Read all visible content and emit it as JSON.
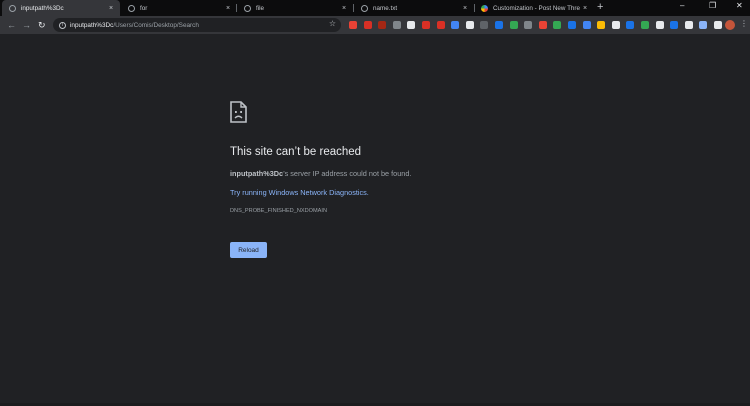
{
  "tabs": [
    {
      "title": "inputpath%3Dc",
      "active": true,
      "icon": "globe-icon"
    },
    {
      "title": "for",
      "active": false,
      "icon": "globe-icon"
    },
    {
      "title": "file",
      "active": false,
      "icon": "globe-icon"
    },
    {
      "title": "name.txt",
      "active": false,
      "icon": "globe-icon"
    },
    {
      "title": "Customization - Post New Thread",
      "active": false,
      "icon": "google-icon"
    }
  ],
  "tab_close_glyph": "×",
  "new_tab_glyph": "+",
  "window_controls": {
    "minimize": "–",
    "maximize": "❐",
    "close": "✕"
  },
  "toolbar": {
    "back": "←",
    "forward": "→",
    "reload": "↻",
    "address_host": "inputpath%3Dc",
    "address_path": "/Users/Comis/Desktop/Search",
    "star": "☆",
    "menu": "⋮"
  },
  "extensions": [
    "#e94235",
    "#d93025",
    "#a52714",
    "#80868b",
    "#e8eaed",
    "#d93025",
    "#d93025",
    "#4285f4",
    "#e8eaed",
    "#5f6368",
    "#1a73e8",
    "#34a853",
    "#80868b",
    "#ea4335",
    "#34a853",
    "#1a73e8",
    "#4285f4",
    "#fbbc05",
    "#e8eaed",
    "#1a73e8",
    "#34a853",
    "#e8eaed",
    "#1a73e8",
    "#e8eaed",
    "#8ab4f8",
    "#e8eaed"
  ],
  "error": {
    "icon": "sad-page-icon",
    "title": "This site can’t be reached",
    "host": "inputpath%3Dc",
    "message_rest": "’s server IP address could not be found.",
    "link": "Try running Windows Network Diagnostics.",
    "code": "DNS_PROBE_FINISHED_NXDOMAIN",
    "reload_label": "Reload"
  },
  "colors": {
    "background": "#202124",
    "tab_strip": "#0c0c0d",
    "toolbar": "#35363a",
    "link": "#8ab4f8",
    "button": "#8ab4f8"
  }
}
